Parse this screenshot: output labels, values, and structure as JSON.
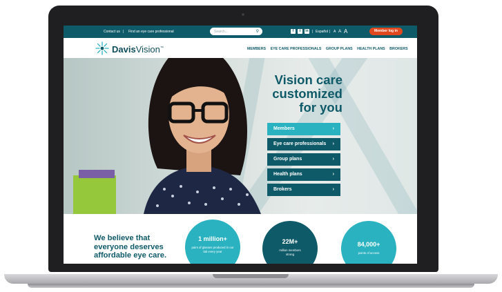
{
  "topbar": {
    "contact_label": "Contact us",
    "divider": "|",
    "find_label": "Find an eye care professional",
    "search_placeholder": "Search...",
    "espanol_label": "Español",
    "text_size_small": "A",
    "text_size_medium": "A",
    "text_size_large": "A",
    "login_label": "Member log in",
    "social_icons": [
      "facebook-icon",
      "twitter-icon",
      "linkedin-icon"
    ]
  },
  "brand": {
    "name_bold": "Davis",
    "name_light": "Vision",
    "trademark": "™"
  },
  "nav": {
    "items": [
      "MEMBERS",
      "EYE CARE PROFESSIONALS",
      "GROUP PLANS",
      "HEALTH PLANS",
      "BROKERS"
    ]
  },
  "hero": {
    "title_line1": "Vision care",
    "title_line2": "customized",
    "title_line3": "for you",
    "buttons": [
      {
        "label": "Members",
        "color": "#2ab2c0"
      },
      {
        "label": "Eye care professionals",
        "color": "#0f5a68"
      },
      {
        "label": "Group plans",
        "color": "#0f5a68"
      },
      {
        "label": "Health plans",
        "color": "#0f5a68"
      },
      {
        "label": "Brokers",
        "color": "#0f5a68"
      }
    ],
    "chevron": "›"
  },
  "stats": {
    "headline_line1": "We believe that",
    "headline_line2": "everyone deserves",
    "headline_line3": "affordable eye care.",
    "items": [
      {
        "value": "1 million+",
        "caption": "pairs of glasses produced in our lab every year",
        "color": "#2ab2c0"
      },
      {
        "value": "22M+",
        "caption": "million members strong",
        "color": "#0f5a68"
      },
      {
        "value": "84,000+",
        "caption": "points of access",
        "color": "#2ab2c0"
      }
    ]
  },
  "colors": {
    "primary": "#0f5a68",
    "accent": "#2ab2c0",
    "cta": "#e0491f"
  }
}
